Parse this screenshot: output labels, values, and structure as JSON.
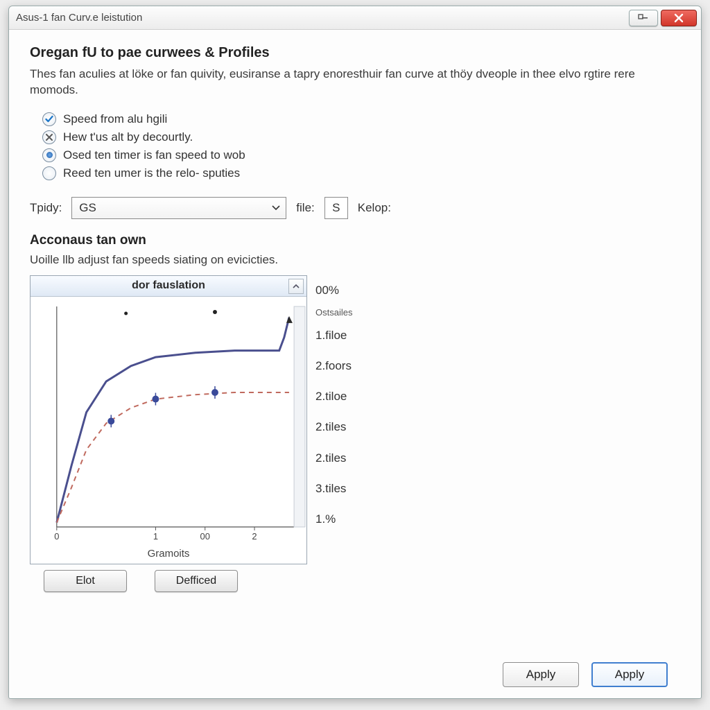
{
  "window": {
    "title": "Asus-1 fan Curv.e leistution"
  },
  "section1": {
    "heading": "Oregan fU to pae curwees & Profiles",
    "blurb": "Thes fan aculies at löke or fan quivity, eusiranse a tapry enoresthuir fan curve at thöy dveople in thee elvo rgtire rere momods.",
    "options": [
      {
        "label": "Speed from alu hgili",
        "state": "check"
      },
      {
        "label": "Hew t'us alt by decourtly.",
        "state": "cross"
      },
      {
        "label": "Osed ten timer is fan speed to wob",
        "state": "dot"
      },
      {
        "label": "Reed ten umer is the relo- sputies",
        "state": "empty"
      }
    ],
    "select": {
      "label": "Tpidy:",
      "value": "GS",
      "file_label": "file:",
      "file_value": "S",
      "kelop": "Kelop:"
    }
  },
  "section2": {
    "heading": "Acconaus tan own",
    "blurb": "Uoille llb adjust fan speeds siating on evicicties."
  },
  "chart": {
    "header": "dor fauslation",
    "xlabel": "Gramoits",
    "buttons": {
      "left": "Elot",
      "right": "Defficed"
    }
  },
  "rightlist": {
    "top": "00%",
    "small": "Ostsailes",
    "items": [
      "1.filoe",
      "2.foors",
      "2.tiloe",
      "2.tiles",
      "2.tiles",
      "3.tiles",
      "1.%"
    ]
  },
  "footer": {
    "left": "Apply",
    "right": "Apply"
  },
  "chart_data": {
    "type": "line",
    "xlabel": "Gramoits",
    "ylabel": "",
    "xlim": [
      0,
      2.4
    ],
    "ylim": [
      0,
      100
    ],
    "x_ticks": [
      0,
      1,
      2
    ],
    "x_tick_labels": [
      "0",
      "1",
      "00",
      "2"
    ],
    "series": [
      {
        "name": "solid",
        "style": "solid",
        "color": "#4a4f8e",
        "x": [
          0.0,
          0.15,
          0.3,
          0.5,
          0.75,
          1.0,
          1.4,
          1.8,
          2.1,
          2.25,
          2.3,
          2.35
        ],
        "y": [
          2,
          28,
          52,
          66,
          73,
          77,
          79,
          80,
          80,
          80,
          86,
          95
        ]
      },
      {
        "name": "dashed",
        "style": "dashed",
        "color": "#c06a5e",
        "x": [
          0.0,
          0.15,
          0.3,
          0.5,
          0.75,
          1.0,
          1.4,
          1.8,
          2.1,
          2.35
        ],
        "y": [
          2,
          18,
          35,
          47,
          54,
          58,
          60,
          61,
          61,
          61
        ]
      }
    ],
    "markers": {
      "series": "dashed",
      "points": [
        {
          "x": 0.55,
          "y": 48
        },
        {
          "x": 1.0,
          "y": 58
        },
        {
          "x": 1.6,
          "y": 61
        }
      ]
    }
  }
}
